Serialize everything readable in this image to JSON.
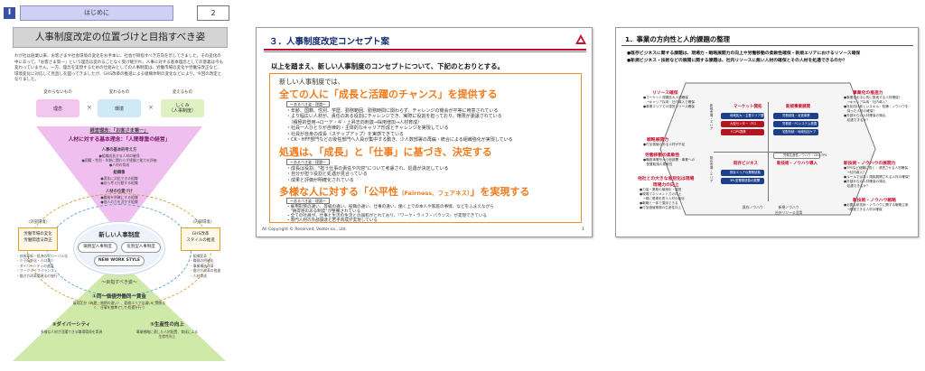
{
  "slide1": {
    "section_label": "I",
    "tab_label": "はじめに",
    "page_number": "2",
    "title": "人事制度改定の位置づけと目指すべき姿",
    "intro": "わが社は創業以来、お客さまや社会環境の変化をお手本に、社会が目指すべき方向を示してきました。その変化の中にあって、「お客さま第一」という理念は変わることなく受け継がれ、人事に対する基本理念としての意義は今も変わっていません。一方、理念を実現するための仕組みとしての人事制度は、労働市場の変化や労働法改正など、環境変化に対応して見直しを図ってきましたが、GHS改革の推進による組織体制の変化などにより、今回の改定となりました。",
    "row_labels": [
      "変わらないもの",
      "変わるもの",
      "変えるもの"
    ],
    "boxes": [
      "理念",
      "環境",
      "しくみ\n（人事制度）"
    ],
    "keiei_rinen": "経営理念：「お客さま第一」",
    "jinzai_rinen": "人材に対する基本理念：「人間尊重の経営」",
    "basic_thinking": "人事の基本的考え方",
    "basic_lines": "●組織成長する人材の確保\n●国籍・性別・年齢に関わらず経験と能力を評価\n●人材の育成",
    "soshikizo": "組織像",
    "soshikizo_lines": "●変化に対応できる組織\n●自ら考え行動する組織",
    "jinzaizo": "人材の位置づけ",
    "jinzaizo_lines": "●職務を明確にする組織\n●個人の力を活かす組織",
    "center_title": "新しい人事制度",
    "pill_left": "職務型人事制度",
    "pill_right": "役割型人事制度",
    "pill_bottom": "NEW WORK STYLE",
    "left_box": "労働市場の変化\n労働関連法改正",
    "left_caption": "〈外部環境〉",
    "right_box": "GHS改革\nスタイルの推進",
    "right_caption": "〈内部環境〉",
    "left_list": "・技術革新・経済のグローバル化\n・少子高齢化・人口減少\n・ダイバーシティの進展\n・ワークライフバランス\n・働き方改革関連法の施行",
    "right_list": "・組織変革\n・職務の明確化\n・事業構造改革\n・働き方改革の推進\n・人材育成",
    "goal_label": "〜目指すべき姿〜",
    "goal1": "①同一価値労働同一賃金",
    "goal1_note": "雇用区分（有期・無期の違い）、勤務エリアの違いに関係なく、仕事を基準とした処遇を行う",
    "goal2": "②ダイバーシティ",
    "goal2_note": "多様な人材が活躍できる職場環境を実現",
    "goal3": "③生産性の向上",
    "goal3_note": "事業戦略に適した人材配置、育成による生産性向上"
  },
  "slide2": {
    "title": "３．人事制度改定コンセプト案",
    "lead": "以上を踏まえ、新しい人事制度のコンセプトについて、下記のとおりとする。",
    "sub": "新しい人事制度では、",
    "head1": "全ての人に「成長と活躍のチャンス」を提供する",
    "tag1": "〜あるべき姿・理論〜",
    "lines1": "・年齢、国籍、性別、学歴、勤務範囲、勤務時間に関わらず、チャレンジの機会が平等に用意されている\n・より幅広い人材が、責任のある役割にチャレンジでき、実際に役割を担っており、権限が委譲されている\n　（積極的登用→ローテ・ギ・上昇志向刺激→採用増加→人材育成）\n・社員一人ひとりが自律的・主体的なキャリア形成とチャレンジを実現している\n・社員が自身の成長（ステップアップ）を実感できている\n・CK・HFF部門などの後任部門へ人員が集中する動き、少人数部署の再編・統合による組織強化が実現している",
    "head2": "処遇は、「成長」と「仕事」に基づき、決定する",
    "tag2": "〜あるべき姿・理論〜",
    "lines2": "・成長は役割、\"担う仕事の責任や内容\"について考慮され、処遇が決定している\n・自分が担う役割と処遇が見合っている\n・成果と評価が明確化されている",
    "head3_pre": "多様な人に対する「公平性",
    "head3_small": "（Fairness、フェアネス）",
    "head3_post": "」を実現する",
    "tag3": "〜あるべき姿・理論〜",
    "lines3": "・雇用形態の違い、等級の違い、役職の違い、仕事の違い、働く上での本人や家庭の事情、などをふまえながら\n　\"納得感のある制度\"が整備されている\n・全ての社員が、仕事と生活の生活との調和がとれており、『ワーク・ライフ・バランス』が実現できている\n・専門人材の外部調達と若手育成が実現している",
    "footer": "All Copyright © Reserved, Vector co., Ltd.",
    "page": "1"
  },
  "slide3": {
    "title": "1．事業の方向性と人的課題の整理",
    "bullet1": "●既存ビジネスに関する課題は、現場力・戦略展開力の向上や労働移動の柔軟性確保・新規エリアにおけるリソース確保",
    "bullet2": "●新規ビジネス・技術などの展開に関する課題は、社内リソースに無い人材の確保とその人材を処遇できるのか？",
    "left_top_head": "リソース確保",
    "left_top_notes": "●マーケット規模拡大人材確保\n　→キャリア採用・社内導入で確保\n●事業エリアでの運営リソース確保",
    "left_mid_head": "戦略展開力",
    "left_mid_notes": "●付加価値のある人材が不足",
    "left_mid2_head": "労働移動の柔軟性",
    "left_mid2_notes": "●職務事業所から他部署・事業への\n　配置転換の柔軟性",
    "left_bot_head": "他社との大きな差別化は現場\n現場力の向上",
    "left_bot_notes": "●力量・業務の最適化・運営\n●現場マネジメント力の向上\n　→現に現場を担う人材の強化\n●戦略と一体で運用できる\n●付加価値業務の生産性向上",
    "right_top_head": "事業化の推進力",
    "right_top_notes": "●事業化を中心的に推進する人材確保？\n　→キャリア採用・社内導入？\n●社化向け新しいスキル・知識・ノウハウを\n　持った人材の確保？\n●外部からの人材確保の場合、\n　処遇できるか？",
    "right_mid_head": "新技術・ノウハウの展開力",
    "right_mid_notes": "●TPSなど経験に長く・浸透させる人材確保\n　→社内導入？\n●ルールではなく頭脳展開される人材の確保？\n●外部からの人材確保の場合、\n　処遇できるか？",
    "right_bot_head": "新技術・ノウハウ戦略",
    "right_bot_notes": "●必要な新技術・ノウハウに関する戦略立案\n　→推進できる人材の確保",
    "q_tl": "マーケット開拓",
    "q_tr": "新規事業展開",
    "q_bl": "既存ビジネス",
    "q_br": "新技術・ノウハウ導入",
    "chips_tl": [
      "地域拡大・主要エリア展開",
      "大型センター（FC）",
      "ドロPS提携"
    ],
    "chips_tr": [
      "労務請負・派遣事業",
      "労務請・FCシステム発掘",
      "宅配系統・地域包括ケア"
    ],
    "chips_bl": [
      "既存エリアの業務請負",
      "3PL型業務請負の展開"
    ],
    "chips_br": [
      "労働生産性ノウハウ・CB＆TPS"
    ],
    "axis_left_top": "新規市場・エリア",
    "axis_left_bot": "既存市場・エリア",
    "axis_bottom_left": "既存ノウハウ",
    "axis_bottom_right": "新規ノウハウ\n社外リソース活用"
  }
}
